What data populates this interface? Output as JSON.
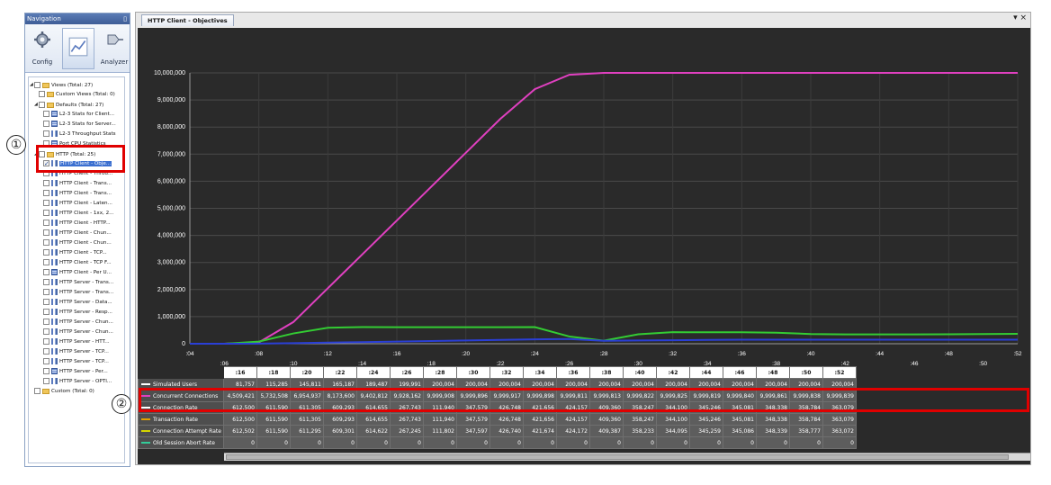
{
  "nav": {
    "title": "Navigation",
    "pin": "▯",
    "buttons": {
      "config": "Config",
      "analyzer": "Analyzer"
    }
  },
  "tree": [
    {
      "label": "Views (Total: 27)",
      "indent": 0,
      "kind": "folder",
      "expand": "◢"
    },
    {
      "label": "Custom Views (Total: 0)",
      "indent": 1,
      "kind": "folder"
    },
    {
      "label": "Defaults (Total: 27)",
      "indent": 1,
      "kind": "folder",
      "expand": "◢"
    },
    {
      "label": "L2-3 Stats for Client...",
      "indent": 2,
      "kind": "grid"
    },
    {
      "label": "L2-3 Stats for Server...",
      "indent": 2,
      "kind": "grid"
    },
    {
      "label": "L2-3 Throughput Stats",
      "indent": 2,
      "kind": "bar"
    },
    {
      "label": "Port CPU Statistics",
      "indent": 2,
      "kind": "grid"
    },
    {
      "label": "HTTP (Total: 25)",
      "indent": 1,
      "kind": "folder",
      "expand": "◢"
    },
    {
      "label": "HTTP Client - Obje...",
      "indent": 2,
      "kind": "bar",
      "checked": true,
      "selected": true
    },
    {
      "label": "HTTP Client - Throu...",
      "indent": 2,
      "kind": "bar"
    },
    {
      "label": "HTTP Client - Trans...",
      "indent": 2,
      "kind": "bar"
    },
    {
      "label": "HTTP Client - Trans...",
      "indent": 2,
      "kind": "bar"
    },
    {
      "label": "HTTP Client - Laten...",
      "indent": 2,
      "kind": "bar"
    },
    {
      "label": "HTTP Client - 1xx, 2...",
      "indent": 2,
      "kind": "bar"
    },
    {
      "label": "HTTP Client - HTTP...",
      "indent": 2,
      "kind": "bar"
    },
    {
      "label": "HTTP Client - Chun...",
      "indent": 2,
      "kind": "bar"
    },
    {
      "label": "HTTP Client - Chun...",
      "indent": 2,
      "kind": "bar"
    },
    {
      "label": "HTTP Client - TCP...",
      "indent": 2,
      "kind": "bar"
    },
    {
      "label": "HTTP Client - TCP F...",
      "indent": 2,
      "kind": "bar"
    },
    {
      "label": "HTTP Client - Per U...",
      "indent": 2,
      "kind": "grid"
    },
    {
      "label": "HTTP Server - Trans...",
      "indent": 2,
      "kind": "bar"
    },
    {
      "label": "HTTP Server - Trans...",
      "indent": 2,
      "kind": "bar"
    },
    {
      "label": "HTTP Server - Data...",
      "indent": 2,
      "kind": "bar"
    },
    {
      "label": "HTTP Server - Resp...",
      "indent": 2,
      "kind": "bar"
    },
    {
      "label": "HTTP Server - Chun...",
      "indent": 2,
      "kind": "bar"
    },
    {
      "label": "HTTP Server - Chun...",
      "indent": 2,
      "kind": "bar"
    },
    {
      "label": "HTTP Server - HTT...",
      "indent": 2,
      "kind": "bar"
    },
    {
      "label": "HTTP Server - TCP...",
      "indent": 2,
      "kind": "bar"
    },
    {
      "label": "HTTP Server - TCP...",
      "indent": 2,
      "kind": "bar"
    },
    {
      "label": "HTTP Server - Per...",
      "indent": 2,
      "kind": "grid"
    },
    {
      "label": "HTTP Server - OPTI...",
      "indent": 2,
      "kind": "bar"
    },
    {
      "label": "Custom (Total: 0)",
      "indent": 0,
      "kind": "folder"
    }
  ],
  "main": {
    "tab_title": "HTTP Client - Objectives",
    "tab_controls": "▾ ×"
  },
  "callouts": {
    "one": "①",
    "two": "②"
  },
  "chart_data": {
    "type": "line",
    "y_ticks": [
      "10,000,000",
      "9,000,000",
      "8,000,000",
      "7,000,000",
      "6,000,000",
      "5,000,000",
      "4,000,000",
      "3,000,000",
      "2,000,000",
      "1,000,000",
      "0"
    ],
    "ylim": [
      0,
      10000000
    ],
    "x_ticks_upper": [
      ":04",
      ":08",
      ":12",
      ":16",
      ":20",
      ":24",
      ":28",
      ":32",
      ":36",
      ":40",
      ":44",
      ":48",
      ":52"
    ],
    "x_ticks_lower": [
      ":06",
      ":10",
      ":14",
      ":18",
      ":22",
      ":26",
      ":30",
      ":34",
      ":38",
      ":42",
      ":46",
      ":50"
    ],
    "x": [
      4,
      6,
      8,
      10,
      12,
      14,
      16,
      18,
      20,
      22,
      24,
      26,
      28,
      30,
      32,
      34,
      36,
      38,
      40,
      42,
      44,
      46,
      48,
      50,
      52
    ],
    "series": [
      {
        "color": "#e040c0",
        "values": [
          0,
          0,
          50000,
          800000,
          2050000,
          3300000,
          4550000,
          5800000,
          7050000,
          8300000,
          9400000,
          9930000,
          9999000,
          9999000,
          9999000,
          9999000,
          9999000,
          9999000,
          9999000,
          9999000,
          9999000,
          9999000,
          9999000,
          9999000,
          9999000
        ]
      },
      {
        "color": "#33cc33",
        "values": [
          0,
          0,
          80000,
          380000,
          590000,
          615000,
          612000,
          611000,
          611000,
          609000,
          614000,
          268000,
          112000,
          348000,
          427000,
          422000,
          424000,
          409000,
          358000,
          344000,
          345000,
          345000,
          348000,
          359000,
          364000
        ]
      },
      {
        "color": "#2a3fd6",
        "values": [
          0,
          0,
          5000,
          20000,
          40000,
          60000,
          80000,
          100000,
          120000,
          140000,
          160000,
          175000,
          110000,
          120000,
          130000,
          140000,
          150000,
          150000,
          150000,
          150000,
          150000,
          150000,
          150000,
          150000,
          150000
        ]
      }
    ]
  },
  "grid": {
    "columns": [
      ":16",
      ":18",
      ":20",
      ":22",
      ":24",
      ":26",
      ":28",
      ":30",
      ":32",
      ":34",
      ":36",
      ":38",
      ":40",
      ":42",
      ":44",
      ":46",
      ":48",
      ":50",
      ":52"
    ],
    "rows": [
      {
        "name": "Simulated Users",
        "color": "#ffffff",
        "cells": [
          "81,757",
          "115,285",
          "145,811",
          "165,187",
          "189,487",
          "199,991",
          "200,004",
          "200,004",
          "200,004",
          "200,004",
          "200,004",
          "200,004",
          "200,004",
          "200,004",
          "200,004",
          "200,004",
          "200,004",
          "200,004",
          "200,004"
        ]
      },
      {
        "name": "Concurrent Connections",
        "color": "#e040c0",
        "cells": [
          "4,509,421",
          "5,732,508",
          "6,954,937",
          "8,173,600",
          "9,402,812",
          "9,928,162",
          "9,999,908",
          "9,999,896",
          "9,999,917",
          "9,999,898",
          "9,999,811",
          "9,999,813",
          "9,999,822",
          "9,999,825",
          "9,999,819",
          "9,999,840",
          "9,999,861",
          "9,999,838",
          "9,999,839"
        ]
      },
      {
        "name": "Connection Rate",
        "color": "#ffffff",
        "cells": [
          "612,500",
          "611,590",
          "611,305",
          "609,293",
          "614,655",
          "267,743",
          "111,940",
          "347,579",
          "426,748",
          "421,656",
          "424,157",
          "409,360",
          "358,247",
          "344,100",
          "345,246",
          "345,081",
          "348,338",
          "358,784",
          "363,079"
        ]
      },
      {
        "name": "Transaction Rate",
        "color": "#e0a000",
        "cells": [
          "612,500",
          "611,590",
          "611,305",
          "609,293",
          "614,655",
          "267,743",
          "111,940",
          "347,579",
          "426,748",
          "421,656",
          "424,157",
          "409,360",
          "358,247",
          "344,100",
          "345,246",
          "345,081",
          "348,338",
          "358,784",
          "363,079"
        ]
      },
      {
        "name": "Connection Attempt Rate",
        "color": "#d6d600",
        "cells": [
          "612,502",
          "611,590",
          "611,295",
          "609,301",
          "614,622",
          "267,245",
          "111,802",
          "347,597",
          "426,740",
          "421,674",
          "424,172",
          "409,387",
          "358,233",
          "344,095",
          "345,259",
          "345,086",
          "348,339",
          "358,777",
          "363,072"
        ]
      },
      {
        "name": "Old Session Abort Rate",
        "color": "#33cc99",
        "cells": [
          "0",
          "0",
          "0",
          "0",
          "0",
          "0",
          "0",
          "0",
          "0",
          "0",
          "0",
          "0",
          "0",
          "0",
          "0",
          "0",
          "0",
          "0",
          "0"
        ]
      }
    ]
  }
}
